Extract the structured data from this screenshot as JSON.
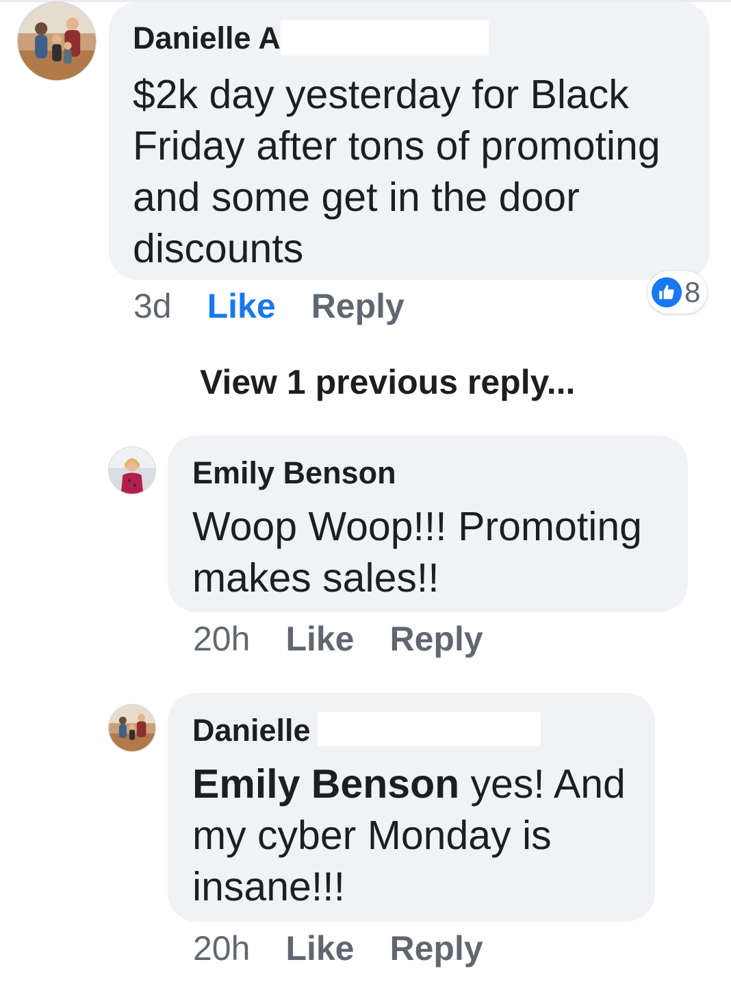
{
  "thread": {
    "comment": {
      "author": "Danielle A",
      "text": "$2k day yesterday for Black Friday after tons of promoting and some get in the door discounts",
      "time": "3d",
      "like_label": "Like",
      "reply_label": "Reply",
      "like_active": true,
      "reaction": {
        "icon": "thumbs-up-icon",
        "count": "8",
        "color": "#1877f2"
      }
    },
    "view_previous_label": "View 1 previous reply...",
    "replies": [
      {
        "author": "Emily Benson",
        "text": "Woop Woop!!! Promoting makes sales!!",
        "time": "20h",
        "like_label": "Like",
        "reply_label": "Reply"
      },
      {
        "author": "Danielle",
        "mention": "Emily Benson",
        "text": " yes! And my cyber Monday is insane!!!",
        "time": "20h",
        "like_label": "Like",
        "reply_label": "Reply"
      }
    ]
  }
}
